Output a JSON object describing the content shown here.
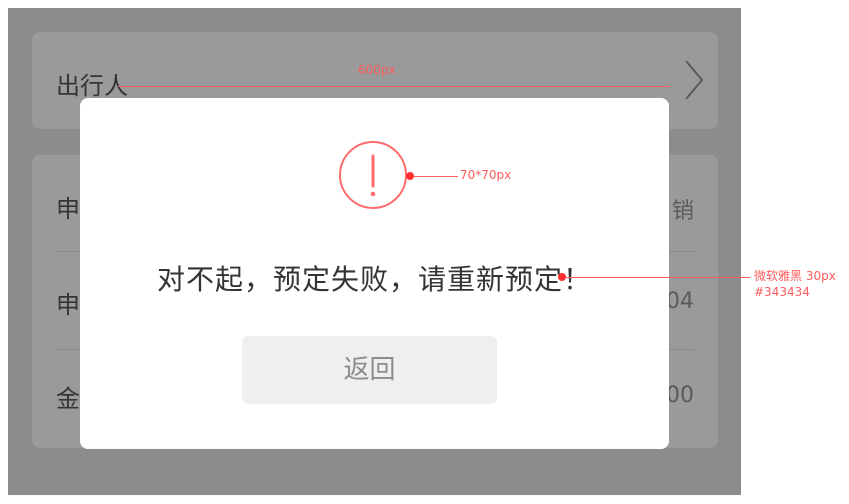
{
  "travelers": {
    "label": "出行人"
  },
  "list": {
    "rows": [
      {
        "label": "申",
        "value": "销"
      },
      {
        "label": "申",
        "value": "04"
      },
      {
        "label": "金",
        "value": "00"
      }
    ]
  },
  "dialog": {
    "message": "对不起，预定失败，请重新预定！",
    "return_label": "返回",
    "accent_color": "#ff6b6b",
    "text_color": "#343434"
  },
  "annotations": {
    "width_note": "600px",
    "icon_size_note": "70*70px",
    "font_note_line1": "微软雅黑 30px",
    "font_note_line2": "#343434"
  }
}
